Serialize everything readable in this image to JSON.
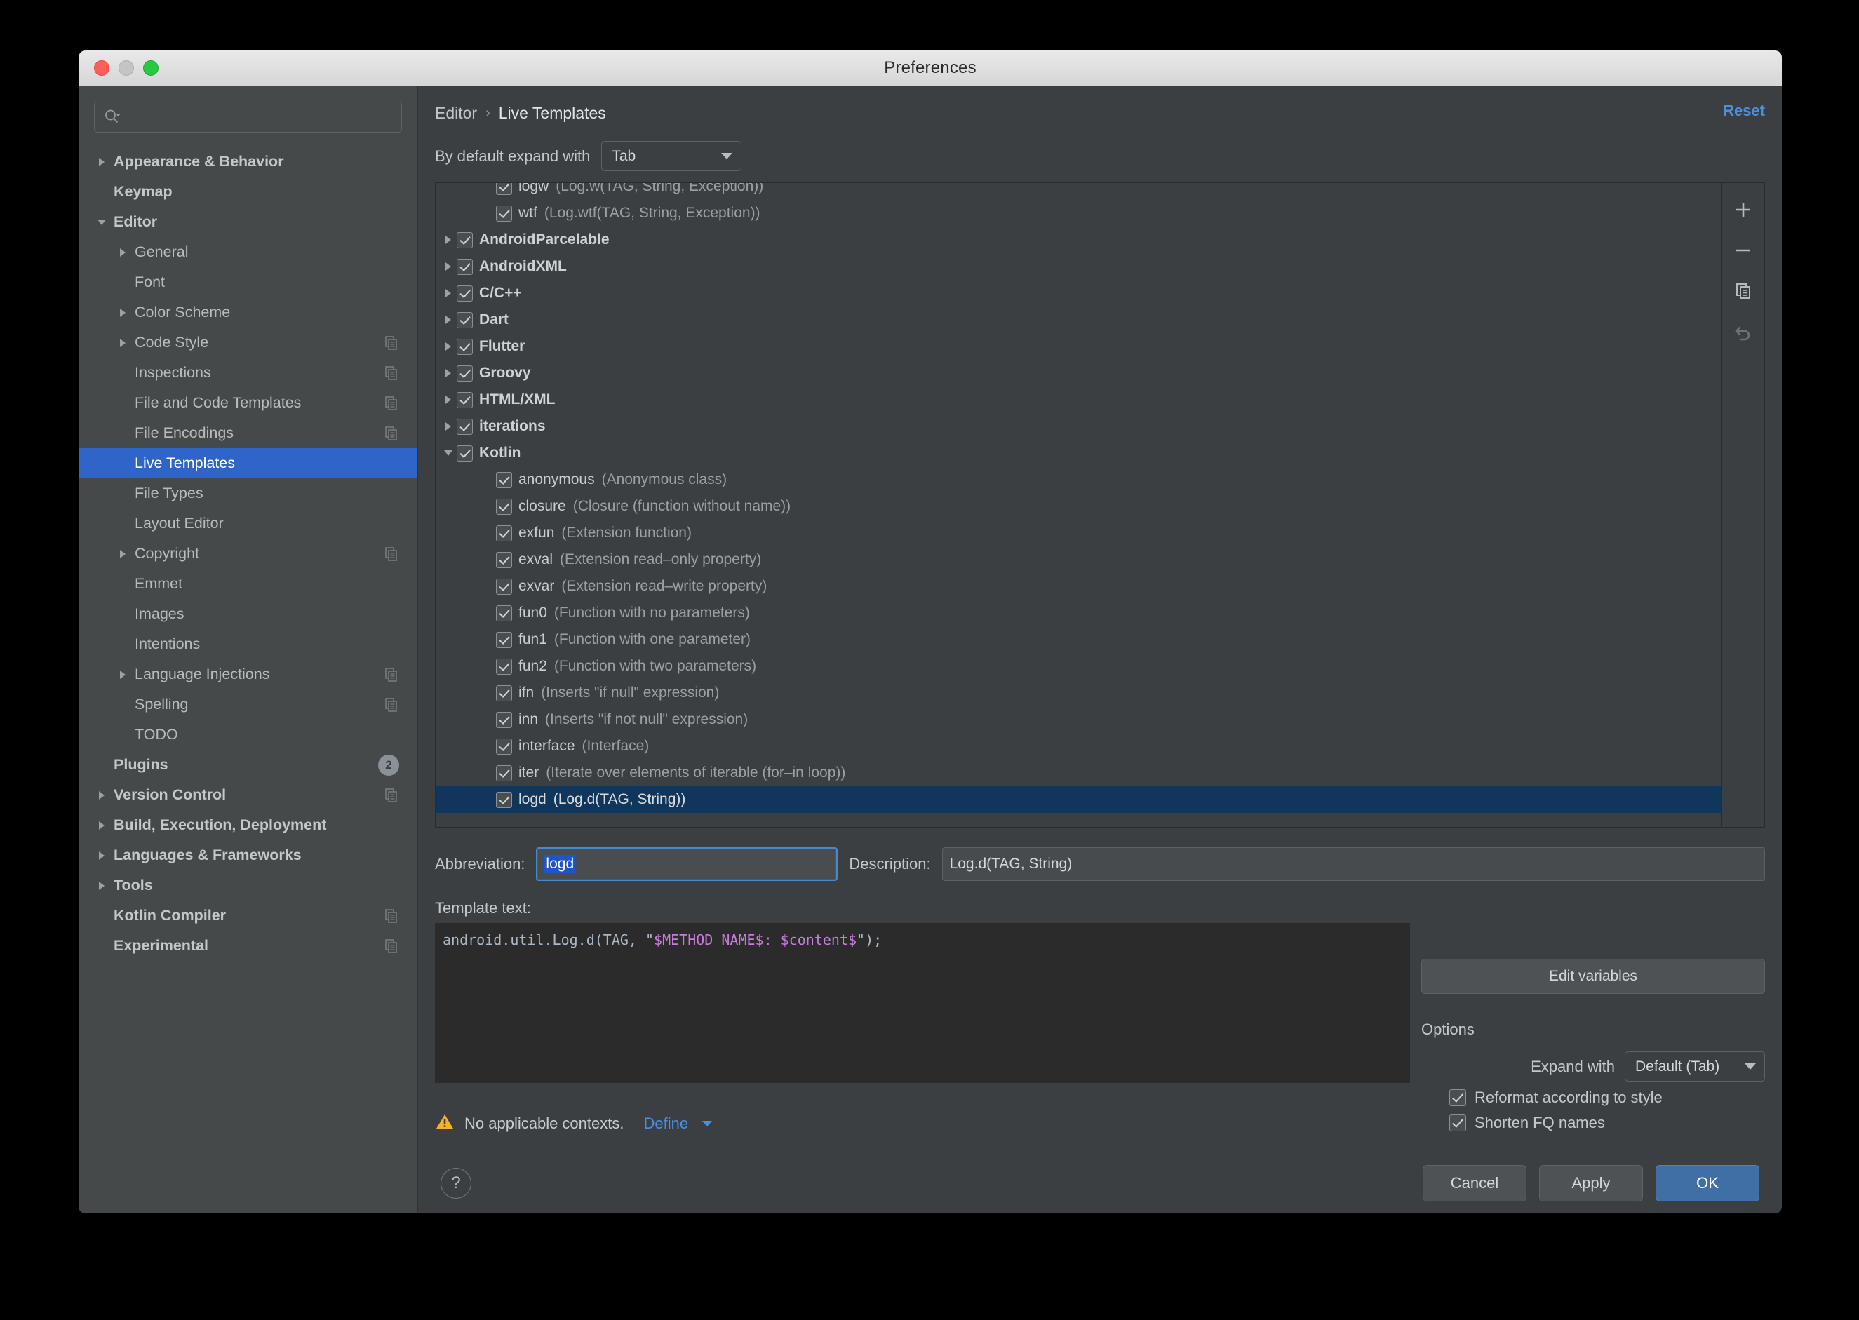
{
  "window": {
    "title": "Preferences",
    "traffic_lights": [
      "close-red",
      "minimize-yellow",
      "zoom-green"
    ]
  },
  "sidebar": {
    "search": {
      "value": "",
      "placeholder": ""
    },
    "items": [
      {
        "label": "Appearance & Behavior",
        "level": 0,
        "twisty": "collapsed",
        "bold": true,
        "badge": ""
      },
      {
        "label": "Keymap",
        "level": 0,
        "twisty": "none",
        "bold": true,
        "badge": ""
      },
      {
        "label": "Editor",
        "level": 0,
        "twisty": "expanded",
        "bold": true,
        "badge": ""
      },
      {
        "label": "General",
        "level": 1,
        "twisty": "collapsed",
        "bold": false,
        "badge": ""
      },
      {
        "label": "Font",
        "level": 1,
        "twisty": "none",
        "bold": false,
        "badge": ""
      },
      {
        "label": "Color Scheme",
        "level": 1,
        "twisty": "collapsed",
        "bold": false,
        "badge": ""
      },
      {
        "label": "Code Style",
        "level": 1,
        "twisty": "collapsed",
        "bold": false,
        "badge": "copy"
      },
      {
        "label": "Inspections",
        "level": 1,
        "twisty": "none",
        "bold": false,
        "badge": "copy"
      },
      {
        "label": "File and Code Templates",
        "level": 1,
        "twisty": "none",
        "bold": false,
        "badge": "copy"
      },
      {
        "label": "File Encodings",
        "level": 1,
        "twisty": "none",
        "bold": false,
        "badge": "copy"
      },
      {
        "label": "Live Templates",
        "level": 1,
        "twisty": "none",
        "bold": false,
        "badge": "",
        "selected": true
      },
      {
        "label": "File Types",
        "level": 1,
        "twisty": "none",
        "bold": false,
        "badge": ""
      },
      {
        "label": "Layout Editor",
        "level": 1,
        "twisty": "none",
        "bold": false,
        "badge": ""
      },
      {
        "label": "Copyright",
        "level": 1,
        "twisty": "collapsed",
        "bold": false,
        "badge": "copy"
      },
      {
        "label": "Emmet",
        "level": 1,
        "twisty": "none",
        "bold": false,
        "badge": ""
      },
      {
        "label": "Images",
        "level": 1,
        "twisty": "none",
        "bold": false,
        "badge": ""
      },
      {
        "label": "Intentions",
        "level": 1,
        "twisty": "none",
        "bold": false,
        "badge": ""
      },
      {
        "label": "Language Injections",
        "level": 1,
        "twisty": "collapsed",
        "bold": false,
        "badge": "copy"
      },
      {
        "label": "Spelling",
        "level": 1,
        "twisty": "none",
        "bold": false,
        "badge": "copy"
      },
      {
        "label": "TODO",
        "level": 1,
        "twisty": "none",
        "bold": false,
        "badge": ""
      },
      {
        "label": "Plugins",
        "level": 0,
        "twisty": "none",
        "bold": true,
        "badge": "2"
      },
      {
        "label": "Version Control",
        "level": 0,
        "twisty": "collapsed",
        "bold": true,
        "badge": "copy"
      },
      {
        "label": "Build, Execution, Deployment",
        "level": 0,
        "twisty": "collapsed",
        "bold": true,
        "badge": ""
      },
      {
        "label": "Languages & Frameworks",
        "level": 0,
        "twisty": "collapsed",
        "bold": true,
        "badge": ""
      },
      {
        "label": "Tools",
        "level": 0,
        "twisty": "collapsed",
        "bold": true,
        "badge": ""
      },
      {
        "label": "Kotlin Compiler",
        "level": 0,
        "twisty": "none",
        "bold": true,
        "badge": "copy"
      },
      {
        "label": "Experimental",
        "level": 0,
        "twisty": "none",
        "bold": true,
        "badge": "copy"
      }
    ]
  },
  "main": {
    "breadcrumb": {
      "root": "Editor",
      "separator": "›",
      "leaf": "Live Templates"
    },
    "reset_label": "Reset",
    "expand_with": {
      "label": "By default expand with",
      "value": "Tab"
    },
    "list_tools": [
      "plus-icon",
      "minus-icon",
      "copy-icon",
      "revert-icon"
    ],
    "templates": [
      {
        "name": "logw",
        "desc": "(Log.w(TAG, String, Exception))",
        "level": 2,
        "twisty": "none",
        "checked": true,
        "group": false,
        "clipped": true
      },
      {
        "name": "wtf",
        "desc": "(Log.wtf(TAG, String, Exception))",
        "level": 2,
        "twisty": "none",
        "checked": true,
        "group": false
      },
      {
        "name": "AndroidParcelable",
        "desc": "",
        "level": 0,
        "twisty": "collapsed",
        "checked": true,
        "group": true
      },
      {
        "name": "AndroidXML",
        "desc": "",
        "level": 0,
        "twisty": "collapsed",
        "checked": true,
        "group": true
      },
      {
        "name": "C/C++",
        "desc": "",
        "level": 0,
        "twisty": "collapsed",
        "checked": true,
        "group": true
      },
      {
        "name": "Dart",
        "desc": "",
        "level": 0,
        "twisty": "collapsed",
        "checked": true,
        "group": true
      },
      {
        "name": "Flutter",
        "desc": "",
        "level": 0,
        "twisty": "collapsed",
        "checked": true,
        "group": true
      },
      {
        "name": "Groovy",
        "desc": "",
        "level": 0,
        "twisty": "collapsed",
        "checked": true,
        "group": true
      },
      {
        "name": "HTML/XML",
        "desc": "",
        "level": 0,
        "twisty": "collapsed",
        "checked": true,
        "group": true
      },
      {
        "name": "iterations",
        "desc": "",
        "level": 0,
        "twisty": "collapsed",
        "checked": true,
        "group": true
      },
      {
        "name": "Kotlin",
        "desc": "",
        "level": 0,
        "twisty": "expanded",
        "checked": true,
        "group": true
      },
      {
        "name": "anonymous",
        "desc": "(Anonymous class)",
        "level": 2,
        "twisty": "none",
        "checked": true,
        "group": false
      },
      {
        "name": "closure",
        "desc": "(Closure (function without name))",
        "level": 2,
        "twisty": "none",
        "checked": true,
        "group": false
      },
      {
        "name": "exfun",
        "desc": "(Extension function)",
        "level": 2,
        "twisty": "none",
        "checked": true,
        "group": false
      },
      {
        "name": "exval",
        "desc": "(Extension read–only property)",
        "level": 2,
        "twisty": "none",
        "checked": true,
        "group": false
      },
      {
        "name": "exvar",
        "desc": "(Extension read–write property)",
        "level": 2,
        "twisty": "none",
        "checked": true,
        "group": false
      },
      {
        "name": "fun0",
        "desc": "(Function with no parameters)",
        "level": 2,
        "twisty": "none",
        "checked": true,
        "group": false
      },
      {
        "name": "fun1",
        "desc": "(Function with one parameter)",
        "level": 2,
        "twisty": "none",
        "checked": true,
        "group": false
      },
      {
        "name": "fun2",
        "desc": "(Function with two parameters)",
        "level": 2,
        "twisty": "none",
        "checked": true,
        "group": false
      },
      {
        "name": "ifn",
        "desc": "(Inserts \"if null\" expression)",
        "level": 2,
        "twisty": "none",
        "checked": true,
        "group": false
      },
      {
        "name": "inn",
        "desc": "(Inserts \"if not null\" expression)",
        "level": 2,
        "twisty": "none",
        "checked": true,
        "group": false
      },
      {
        "name": "interface",
        "desc": "(Interface)",
        "level": 2,
        "twisty": "none",
        "checked": true,
        "group": false
      },
      {
        "name": "iter",
        "desc": "(Iterate over elements of iterable (for–in loop))",
        "level": 2,
        "twisty": "none",
        "checked": true,
        "group": false
      },
      {
        "name": "logd",
        "desc": "(Log.d(TAG, String))",
        "level": 2,
        "twisty": "none",
        "checked": true,
        "group": false,
        "selected": true
      }
    ],
    "abbreviation": {
      "label": "Abbreviation:",
      "value": "logd",
      "selected": true
    },
    "description": {
      "label": "Description:",
      "value": "Log.d(TAG, String)"
    },
    "template_text": {
      "label": "Template text:",
      "prefix": "android.util.Log.d(TAG, \"",
      "var1": "$METHOD_NAME$",
      "mid": ": ",
      "var2": "$content$",
      "suffix": "\");"
    },
    "edit_variables_label": "Edit variables",
    "options": {
      "title": "Options",
      "expand_with": {
        "label": "Expand with",
        "value": "Default (Tab)"
      },
      "checkboxes": [
        {
          "label": "Reformat according to style",
          "checked": true
        },
        {
          "label": "Shorten FQ names",
          "checked": true
        }
      ]
    },
    "context_warning": {
      "icon": "warning-icon",
      "text": "No applicable contexts.",
      "link": "Define"
    }
  },
  "footer": {
    "help_label": "?",
    "buttons": [
      {
        "label": "Cancel",
        "kind": "normal"
      },
      {
        "label": "Apply",
        "kind": "normal"
      },
      {
        "label": "OK",
        "kind": "primary"
      }
    ]
  },
  "colors": {
    "accent_blue": "#2f65c9",
    "link_blue": "#4a90e2",
    "row_selected": "#10365c",
    "bg_panel": "#3c3f41",
    "bg_sidebar": "#45494a",
    "warning_amber": "#f5b324",
    "code_var_purple": "#c77ddb"
  }
}
